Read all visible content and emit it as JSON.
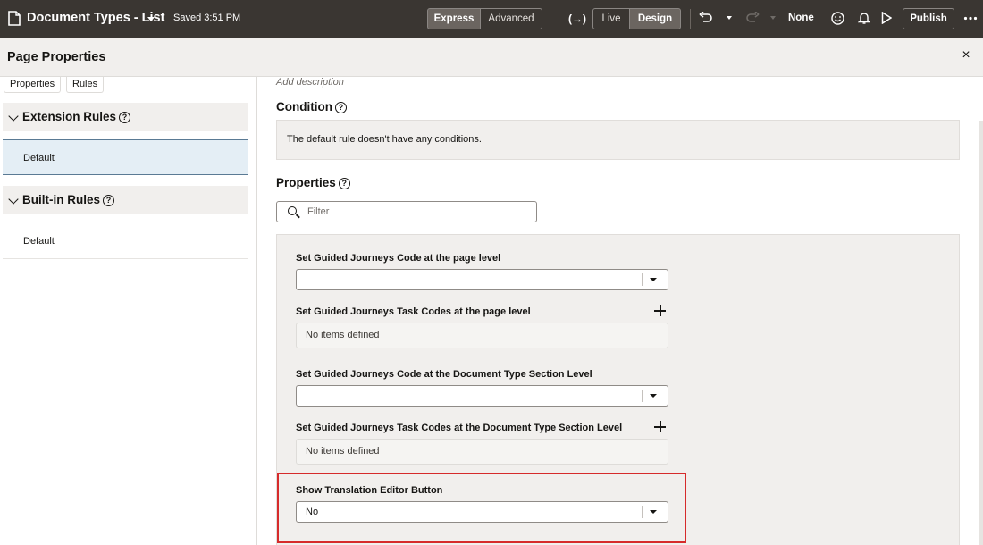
{
  "topbar": {
    "title": "Document Types - List",
    "saved": "Saved 3:51 PM",
    "mode_express": "Express",
    "mode_advanced": "Advanced",
    "live": "Live",
    "design": "Design",
    "bracket_icon": "(→)",
    "none_label": "None",
    "publish": "Publish"
  },
  "panel": {
    "title": "Page Properties",
    "close": "×"
  },
  "left": {
    "tabs": [
      "Properties",
      "Rules"
    ],
    "groups": [
      {
        "label": "Extension Rules",
        "items": [
          "Default"
        ]
      },
      {
        "label": "Built-in Rules",
        "items": [
          "Default"
        ]
      }
    ]
  },
  "main": {
    "add_description": "Add description",
    "condition_title": "Condition",
    "condition_text": "The default rule doesn't have any conditions.",
    "properties_title": "Properties",
    "filter_placeholder": "Filter",
    "fields": [
      {
        "label": "Set Guided Journeys Code at the page level",
        "type": "select",
        "value": ""
      },
      {
        "label": "Set Guided Journeys Task Codes at the page level",
        "type": "list",
        "value": "No items defined"
      },
      {
        "label": "Set Guided Journeys Code at the Document Type Section Level",
        "type": "select",
        "value": ""
      },
      {
        "label": "Set Guided Journeys Task Codes at the Document Type Section Level",
        "type": "list",
        "value": "No items defined"
      },
      {
        "label": "Show Translation Editor Button",
        "type": "select",
        "value": "No"
      }
    ]
  },
  "colors": {
    "topbar_bg": "#3a3632",
    "panel_bg": "#f1efed",
    "selected_rule_bg": "#e4eef5",
    "highlight_border": "#d62b2b"
  }
}
